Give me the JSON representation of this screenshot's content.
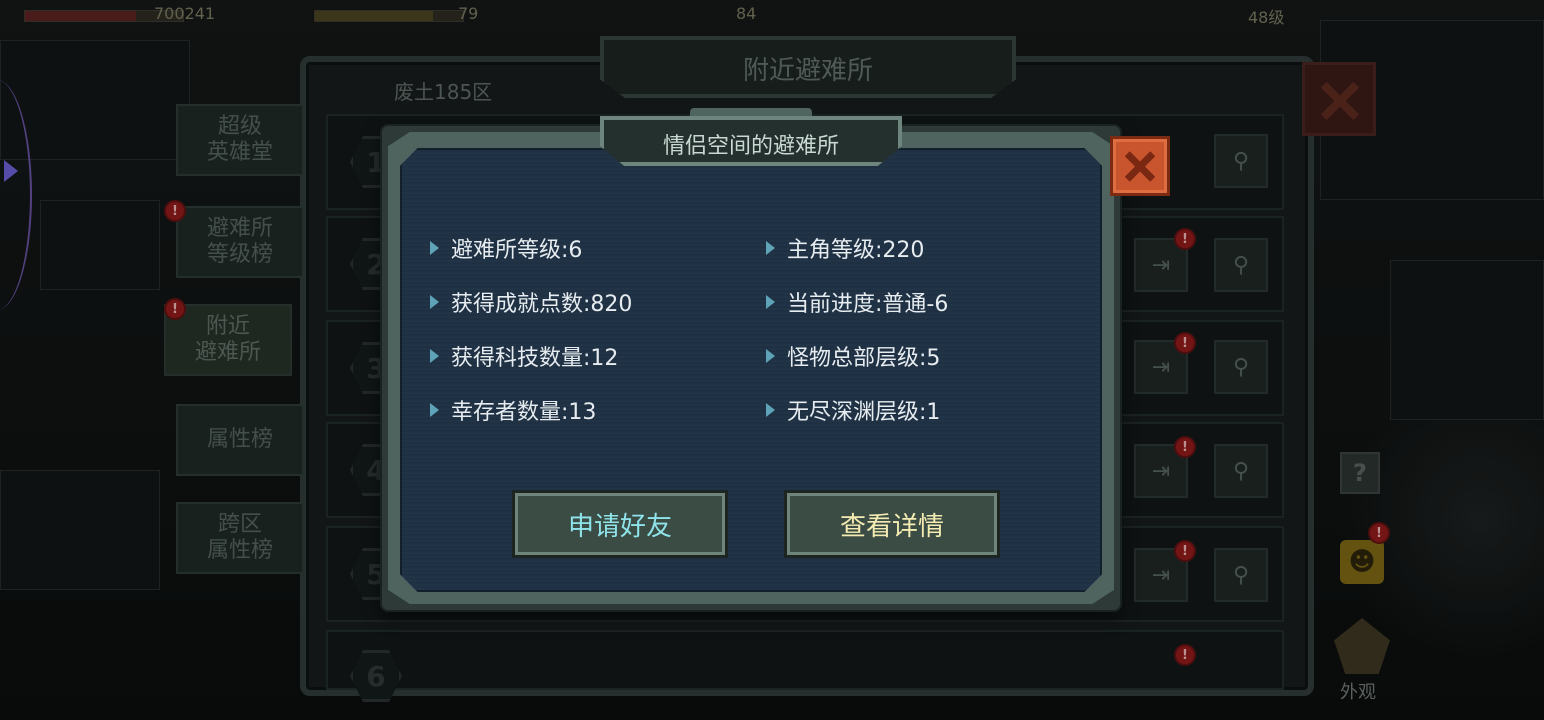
{
  "hud": {
    "power": "700241",
    "energy": "79",
    "resource": "84",
    "level": "48级"
  },
  "back_panel": {
    "title": "附近避难所",
    "zone": "废土185区",
    "tabs": [
      {
        "label": "超级\n英雄堂",
        "active": false,
        "alert": false
      },
      {
        "label": "避难所\n等级榜",
        "active": false,
        "alert": true
      },
      {
        "label": "附近\n避难所",
        "active": true,
        "alert": true
      },
      {
        "label": "属性榜",
        "active": false,
        "alert": false
      },
      {
        "label": "跨区\n属性榜",
        "active": false,
        "alert": false
      }
    ],
    "ranks": [
      "1",
      "2",
      "3",
      "4",
      "5",
      "6"
    ],
    "alert_mark": "!"
  },
  "side_icons": {
    "help": "?",
    "emoji": "☻",
    "appearance_label": "外观"
  },
  "dialog": {
    "title": "情侣空间的避难所",
    "stats_left": [
      "避难所等级:6",
      "获得成就点数:820",
      "获得科技数量:12",
      "幸存者数量:13"
    ],
    "stats_right": [
      "主角等级:220",
      "当前进度:普通-6",
      "怪物总部层级:5",
      "无尽深渊层级:1"
    ],
    "buttons": {
      "add_friend": "申请好友",
      "view_details": "查看详情"
    }
  },
  "icons": {
    "close": "close-icon",
    "search": "magnifier-icon",
    "visit": "enter-door-icon",
    "bullet": "triangle-bullet-icon"
  },
  "colors": {
    "dialog_bg": "#213347",
    "frame": "#4f645e",
    "close_red": "#c8552e",
    "friend_text": "#8fe3ea",
    "detail_text": "#f4ecb2",
    "bullet": "#5fa3b8"
  }
}
